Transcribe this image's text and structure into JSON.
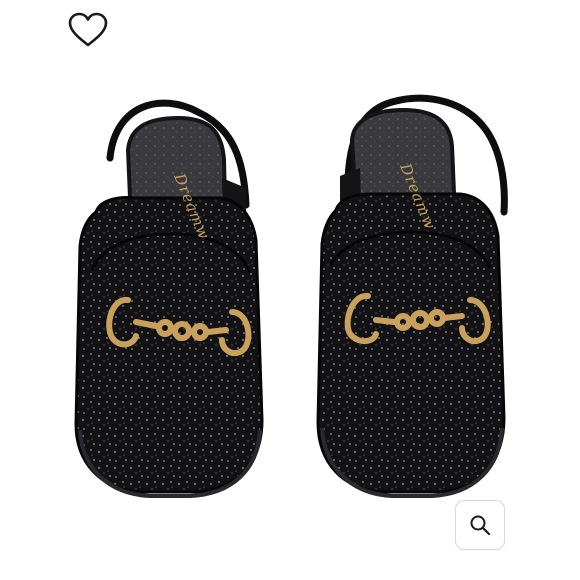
{
  "listing": {
    "brand_insole_text": "Dreamw",
    "colors": {
      "background": "#ffffff",
      "glitter": "#121214",
      "insole": "#3a3a3e",
      "hardware_gold": "#c9a15c",
      "heart_stroke": "#1a1a1a",
      "zoom_border": "#d6d6d6"
    }
  },
  "icons": {
    "favorite": "heart-outline-icon",
    "zoom": "magnifier-icon"
  }
}
